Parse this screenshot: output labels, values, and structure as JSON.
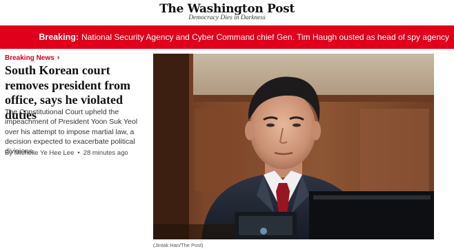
{
  "masthead": {
    "logo": "The Washington Post",
    "tagline": "Democracy Dies in Darkness"
  },
  "breaking_bar": {
    "label": "Breaking:",
    "text": "National Security Agency and Cyber Command chief Gen. Tim Haugh ousted as head of spy agency",
    "color": "#e0001b"
  },
  "story": {
    "kicker": "Breaking News",
    "kicker_icon": "chevron-right-icon",
    "headline": "South Korean court removes president from office, says he violated duties",
    "summary": "The Constitutional Court upheld the impeachment of President Yoon Suk Yeol over his attempt to impose martial law, a decision expected to exacerbate political divisions.",
    "byline_prefix": "By",
    "author": "Michelle Ye Hee Lee",
    "timestamp": "28 minutes ago"
  },
  "photo": {
    "credit": "(Jintak Han/The Post)"
  }
}
